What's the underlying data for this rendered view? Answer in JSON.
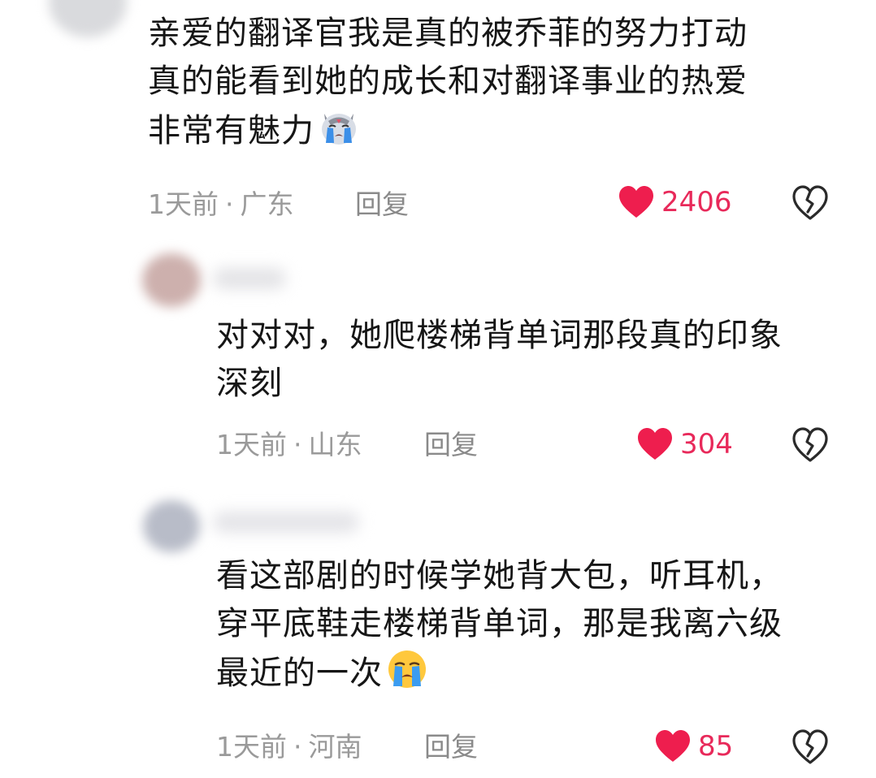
{
  "colors": {
    "like_red": "#ee1e4e",
    "like_count": "#e8295a",
    "meta_gray": "#9a9a9a",
    "text": "#161616"
  },
  "comments": [
    {
      "lines": [
        "亲爱的翻译官我是真的被乔菲的努力打动",
        "真的能看到她的成长和对翻译事业的热爱",
        "非常有魅力"
      ],
      "emoji": "crying-cat-emoji",
      "time": "1天前",
      "location": "广东",
      "reply_label": "回复",
      "likes": "2406",
      "like_icon": "heart-icon",
      "dislike_icon": "broken-heart-icon"
    },
    {
      "lines": [
        "对对对，她爬楼梯背单词那段真的印象",
        "深刻"
      ],
      "time": "1天前",
      "location": "山东",
      "reply_label": "回复",
      "likes": "304",
      "like_icon": "heart-icon",
      "dislike_icon": "broken-heart-icon"
    },
    {
      "lines": [
        "看这部剧的时候学她背大包，听耳机，",
        "穿平底鞋走楼梯背单词，那是我离六级",
        "最近的一次"
      ],
      "emoji": "loudly-crying-face-emoji",
      "time": "1天前",
      "location": "河南",
      "reply_label": "回复",
      "likes": "85",
      "like_icon": "heart-icon",
      "dislike_icon": "broken-heart-icon"
    }
  ]
}
